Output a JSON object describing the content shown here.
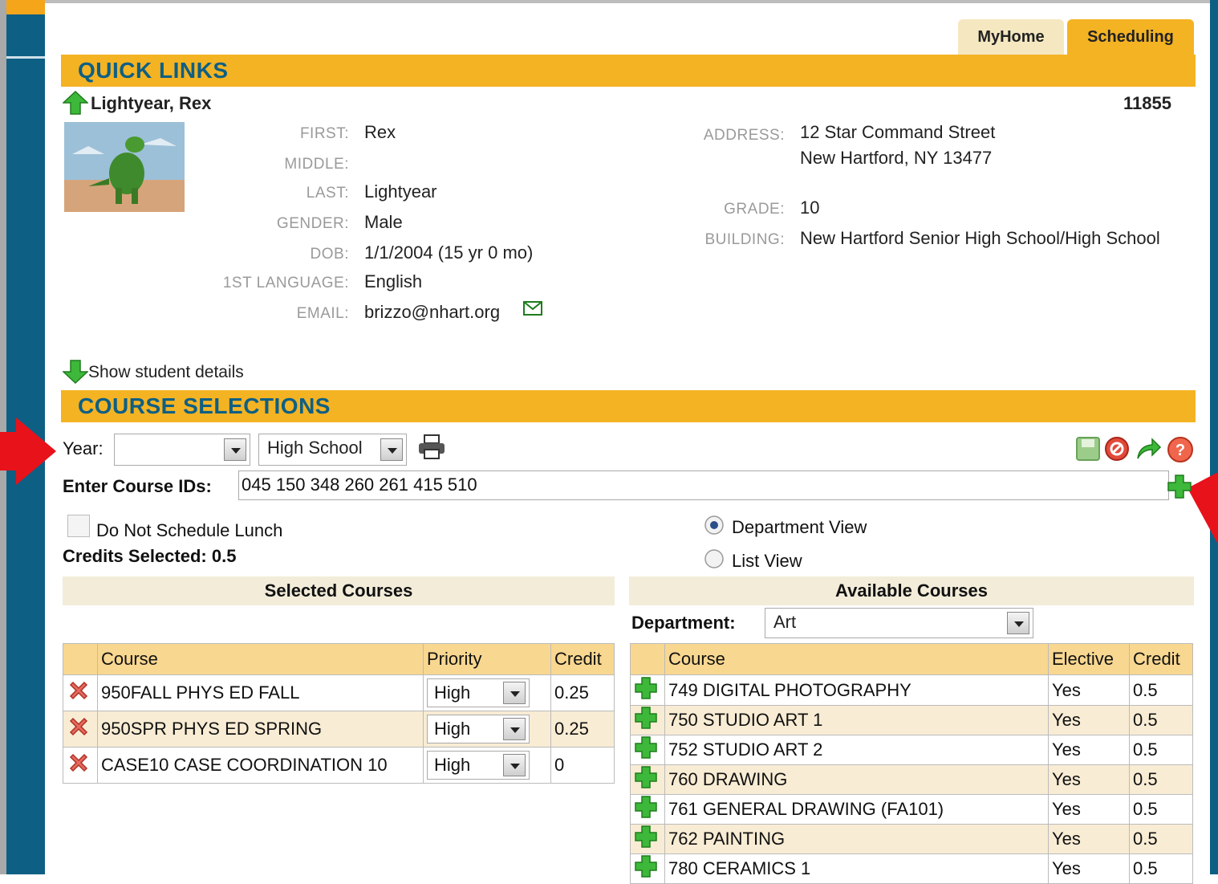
{
  "tabs": [
    {
      "label": "MyHome"
    },
    {
      "label": "Scheduling"
    }
  ],
  "quick_links": {
    "title": "QUICK LINKS"
  },
  "student": {
    "name": "Lightyear, Rex",
    "id": "11855",
    "labels": {
      "first": "FIRST:",
      "middle": "MIDDLE:",
      "last": "LAST:",
      "gender": "GENDER:",
      "dob": "DOB:",
      "language": "1ST LANGUAGE:",
      "email": "EMAIL:",
      "address": "ADDRESS:",
      "grade": "GRADE:",
      "building": "BUILDING:"
    },
    "first": "Rex",
    "middle": "",
    "last": "Lightyear",
    "gender": "Male",
    "dob": "1/1/2004 (15 yr 0 mo)",
    "language": "English",
    "email": "brizzo@nhart.org",
    "address_line1": "12 Star Command Street",
    "address_line2": "New Hartford, NY 13477",
    "grade": "10",
    "building": "New Hartford Senior High School/High School"
  },
  "show_details": "Show student details",
  "course_selections": {
    "title": "COURSE SELECTIONS",
    "year_label": "Year:",
    "year_value": "",
    "school_value": "High School",
    "enter_ids_label": "Enter Course IDs:",
    "enter_ids_value": "045 150 348 260 261 415 510",
    "do_not_schedule_lunch": "Do Not Schedule Lunch",
    "credits_selected": "Credits Selected: 0.5",
    "department_view": "Department View",
    "list_view": "List View",
    "view_selected": "department"
  },
  "selected_courses": {
    "title": "Selected Courses",
    "headers": [
      "Course",
      "Priority",
      "Credit"
    ],
    "rows": [
      {
        "course": "950FALL PHYS ED FALL",
        "priority": "High",
        "credit": "0.25"
      },
      {
        "course": "950SPR PHYS ED SPRING",
        "priority": "High",
        "credit": "0.25"
      },
      {
        "course": "CASE10 CASE COORDINATION 10",
        "priority": "High",
        "credit": "0"
      }
    ]
  },
  "available_courses": {
    "title": "Available Courses",
    "department_label": "Department:",
    "department_value": "Art",
    "headers": [
      "Course",
      "Elective",
      "Credit"
    ],
    "rows": [
      {
        "course": "749 DIGITAL PHOTOGRAPHY",
        "elective": "Yes",
        "credit": "0.5"
      },
      {
        "course": "750 STUDIO ART 1",
        "elective": "Yes",
        "credit": "0.5"
      },
      {
        "course": "752 STUDIO ART 2",
        "elective": "Yes",
        "credit": "0.5"
      },
      {
        "course": "760 DRAWING",
        "elective": "Yes",
        "credit": "0.5"
      },
      {
        "course": "761 GENERAL DRAWING (FA101)",
        "elective": "Yes",
        "credit": "0.5"
      },
      {
        "course": "762 PAINTING",
        "elective": "Yes",
        "credit": "0.5"
      },
      {
        "course": "780 CERAMICS 1",
        "elective": "Yes",
        "credit": "0.5"
      }
    ]
  },
  "colors": {
    "accent_orange": "#f4b323",
    "nav_blue": "#0e5f84",
    "header_tan": "#f8d790",
    "row_tan": "#f8ecd4",
    "annotation_red": "#e8121a"
  }
}
